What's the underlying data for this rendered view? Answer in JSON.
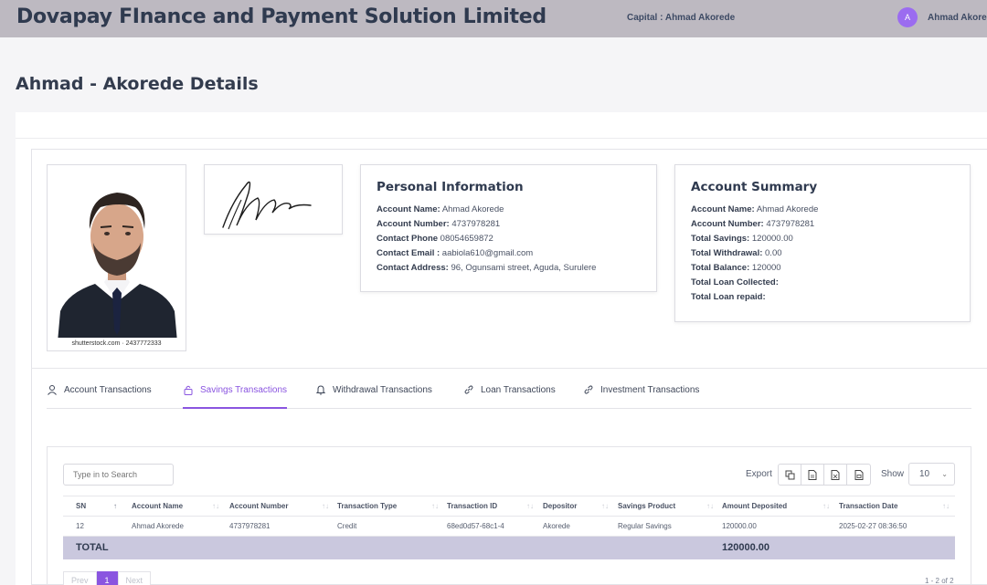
{
  "header": {
    "brand": "Dovapay FInance and Payment Solution Limited",
    "capital": "Capital : Ahmad Akorede",
    "avatar_initial": "A",
    "username": "Ahmad Akorede"
  },
  "page_title": "Ahmad - Akorede Details",
  "profile": {
    "photo_caption": "shutterstock.com · 2437772333"
  },
  "personal_info": {
    "title": "Personal Information",
    "rows": [
      {
        "label": "Account Name:",
        "value": "Ahmad Akorede"
      },
      {
        "label": "Account Number:",
        "value": "4737978281"
      },
      {
        "label": "Contact Phone",
        "value": "08054659872"
      },
      {
        "label": "Contact Email :",
        "value": "aabiola610@gmail.com"
      },
      {
        "label": "Contact Address:",
        "value": "96, Ogunsami street, Aguda, Surulere"
      }
    ]
  },
  "account_summary": {
    "title": "Account Summary",
    "rows": [
      {
        "label": "Account Name:",
        "value": "Ahmad Akorede"
      },
      {
        "label": "Account Number:",
        "value": "4737978281"
      },
      {
        "label": "Total Savings:",
        "value": "120000.00"
      },
      {
        "label": "Total Withdrawal:",
        "value": "0.00"
      },
      {
        "label": "Total Balance:",
        "value": "120000"
      },
      {
        "label": "Total Loan Collected:",
        "value": ""
      },
      {
        "label": "Total Loan repaid:",
        "value": ""
      }
    ]
  },
  "tabs": [
    {
      "label": "Account Transactions",
      "icon": "user-icon"
    },
    {
      "label": "Savings Transactions",
      "icon": "lock-icon"
    },
    {
      "label": "Withdrawal Transactions",
      "icon": "bell-icon"
    },
    {
      "label": "Loan Transactions",
      "icon": "link-icon"
    },
    {
      "label": "Investment Transactions",
      "icon": "link-icon"
    }
  ],
  "active_tab": "Savings Transactions",
  "accent_color": "#8a55e0",
  "table": {
    "search_placeholder": "Type in to Search",
    "export_label": "Export",
    "show_label": "Show",
    "show_value": "10",
    "columns": [
      "SN",
      "Account Name",
      "Account Number",
      "Transaction Type",
      "Transaction ID",
      "Depositor",
      "Savings Product",
      "Amount Deposited",
      "Transaction Date"
    ],
    "rows": [
      [
        "12",
        "Ahmad Akorede",
        "4737978281",
        "Credit",
        "68ed0d57-68c1-4",
        "Akorede",
        "Regular Savings",
        "120000.00",
        "2025-02-27 08:36:50"
      ]
    ],
    "total_label": "TOTAL",
    "total_value": "120000.00"
  },
  "pagination": {
    "prev": "Prev",
    "current": "1",
    "next": "Next",
    "info": "1 - 2 of 2"
  }
}
